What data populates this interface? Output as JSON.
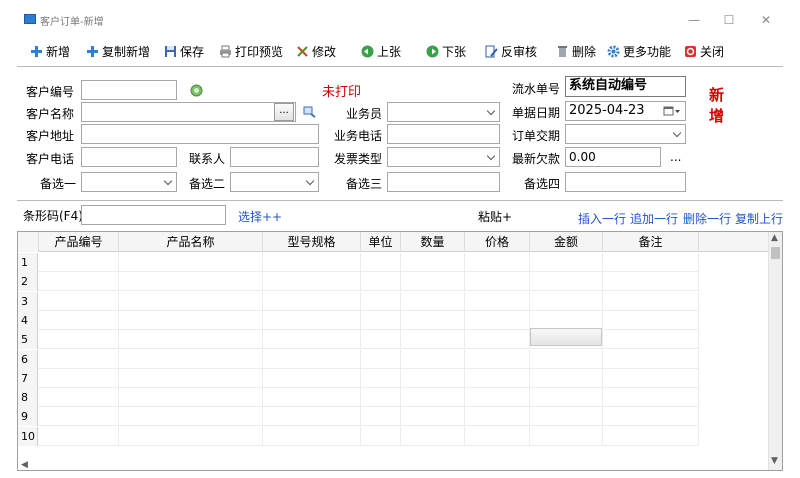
{
  "window": {
    "title": "客户订单-新增",
    "minimize": "—",
    "maximize": "☐",
    "close": "✕"
  },
  "toolbar": {
    "new": "新增",
    "copy_new": "复制新增",
    "save": "保存",
    "print_preview": "打印预览",
    "modify": "修改",
    "prev": "上张",
    "next": "下张",
    "unapprove": "反审核",
    "delete": "删除",
    "more": "更多功能",
    "close": "关闭"
  },
  "form": {
    "customer_code_label": "客户编号",
    "customer_code_value": "",
    "print_status": "未打印",
    "serial_label": "流水单号",
    "serial_value": "系统自动编号",
    "status_badge": "新增",
    "customer_name_label": "客户名称",
    "customer_name_value": "",
    "ellipsis": "...",
    "salesman_label": "业务员",
    "salesman_value": "",
    "date_label": "单据日期",
    "date_value": "2025-04-23",
    "address_label": "客户地址",
    "address_value": "",
    "biz_phone_label": "业务电话",
    "biz_phone_value": "",
    "delivery_label": "订单交期",
    "delivery_value": "",
    "phone_label": "客户电话",
    "phone_value": "",
    "contact_label": "联系人",
    "contact_value": "",
    "invoice_label": "发票类型",
    "invoice_value": "",
    "debt_label": "最新欠款",
    "debt_value": "0.00",
    "debt_ellipsis": "...",
    "opt1_label": "备选一",
    "opt1_value": "",
    "opt2_label": "备选二",
    "opt2_value": "",
    "opt3_label": "备选三",
    "opt3_value": "",
    "opt4_label": "备选四",
    "opt4_value": ""
  },
  "barcode": {
    "label": "条形码(F4)",
    "value": "",
    "select": "选择++",
    "paste": "粘贴+",
    "insert_row": "插入一行",
    "append_row": "追加一行",
    "delete_row": "删除一行",
    "copy_row": "复制上行"
  },
  "table": {
    "columns": [
      "产品编号",
      "产品名称",
      "型号规格",
      "单位",
      "数量",
      "价格",
      "金额",
      "备注"
    ],
    "rows": [
      "1",
      "2",
      "3",
      "4",
      "5",
      "6",
      "7",
      "8",
      "9",
      "10"
    ]
  }
}
